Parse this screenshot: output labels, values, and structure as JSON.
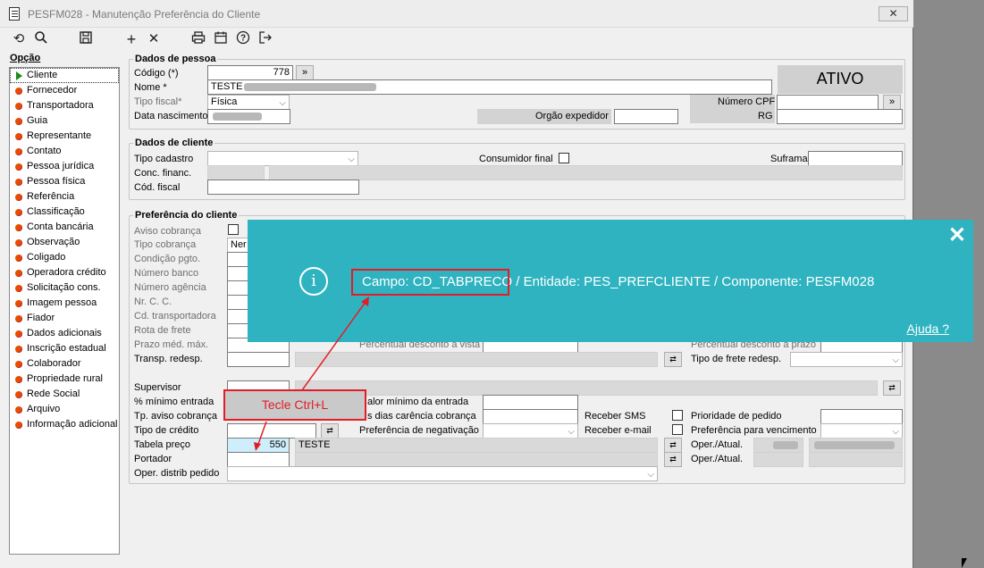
{
  "window": {
    "title": "PESFM028 - Manutenção Preferência do Cliente",
    "close": "✕"
  },
  "toolbar": {
    "items": [
      "undo-icon",
      "search-icon",
      "save-icon",
      "add-icon",
      "delete-icon",
      "print-icon",
      "calendar-icon",
      "help-icon",
      "exit-icon"
    ]
  },
  "sidebar": {
    "label": "Opção",
    "items": [
      "Cliente",
      "Fornecedor",
      "Transportadora",
      "Guia",
      "Representante",
      "Contato",
      "Pessoa jurídica",
      "Pessoa física",
      "Referência",
      "Classificação",
      "Conta bancária",
      "Observação",
      "Coligado",
      "Operadora crédito",
      "Solicitação cons.",
      "Imagem pessoa",
      "Fiador",
      "Dados adicionais",
      "Inscrição estadual",
      "Colaborador",
      "Propriedade rural",
      "Rede Social",
      "Arquivo",
      "Informação adicional"
    ]
  },
  "pessoa": {
    "legend": "Dados de pessoa",
    "codigo_label": "Código (*)",
    "codigo_value": "778",
    "nome_label": "Nome *",
    "nome_value": "TESTE",
    "tipo_fiscal_label": "Tipo fiscal*",
    "tipo_fiscal_value": "Física",
    "nascimento_label": "Data nascimento",
    "orgao_label": "Orgão expedidor",
    "cpf_label": "Número CPF",
    "rg_label": "RG",
    "status": "ATIVO",
    "go_btn": "»"
  },
  "cliente": {
    "legend": "Dados de cliente",
    "tipo_cadastro_label": "Tipo cadastro",
    "consumidor_label": "Consumidor final",
    "suframa_label": "Suframa",
    "conc_label": "Conc. financ.",
    "fiscal_label": "Cód. fiscal"
  },
  "preferencia": {
    "legend": "Preferência do cliente",
    "left_labels": [
      "Aviso cobrança",
      "Tipo cobrança",
      "Condição pgto.",
      "Número banco",
      "Número agência",
      "Nr. C. C.",
      "Cd. transportadora",
      "Rota de frete",
      "Prazo méd. máx.",
      "Transp. redesp."
    ],
    "tipo_cobranca_value": "Ner",
    "perc_vista": "Percentual desconto à vista",
    "perc_prazo": "Percentual desconto à prazo",
    "tipo_frete_redesp": "Tipo de frete redesp.",
    "supervisor": "Supervisor",
    "minimo_entrada": "% mínimo entrada",
    "valor_minimo": "alor mínimo da entrada",
    "tp_aviso": "Tp. aviso cobrança",
    "dias_carencia": "s dias carência cobrança",
    "receber_sms": "Receber SMS",
    "prioridade": "Prioridade de pedido",
    "tipo_credito": "Tipo de crédito",
    "pref_negativacao": "Preferência de negativação",
    "receber_email": "Receber e-mail",
    "pref_vencimento": "Preferência para vencimento",
    "tabela_preco": "Tabela preço",
    "tabela_code": "550",
    "tabela_desc": "TESTE",
    "oper_atual": "Oper./Atual.",
    "portador": "Portador",
    "oper_distrib": "Oper. distrib pedido"
  },
  "popup": {
    "message": "Campo: CD_TABPRECO / Entidade: PES_PREFCLIENTE / Componente: PESFM028",
    "help": "Ajuda ?",
    "close": "✕",
    "icon": "info-icon"
  },
  "annotation": {
    "callout": "Tecle Ctrl+L",
    "color": "#e21d26"
  }
}
